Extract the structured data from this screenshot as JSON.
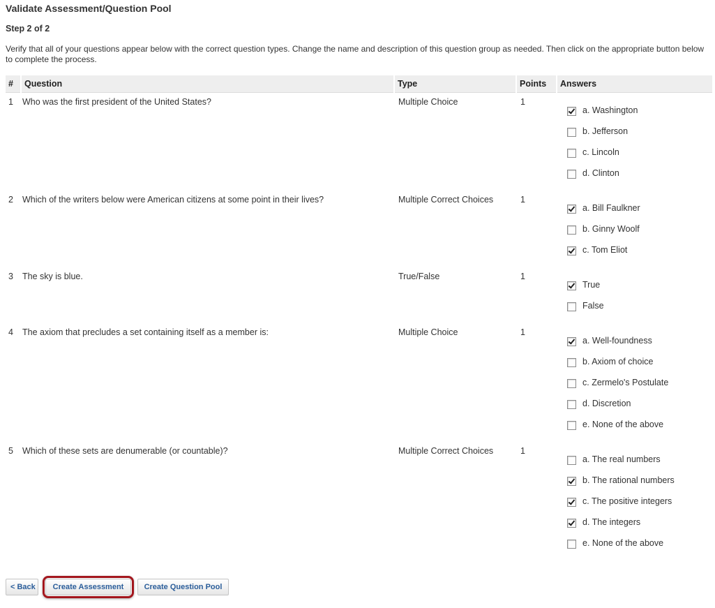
{
  "page": {
    "title": "Validate Assessment/Question Pool",
    "step": "Step 2 of 2",
    "instructions": "Verify that all of your questions appear below with the correct question types. Change the name and description of this question group as needed. Then click on the appropriate button below to complete the process."
  },
  "table": {
    "headers": {
      "num": "#",
      "question": "Question",
      "type": "Type",
      "points": "Points",
      "answers": "Answers"
    },
    "rows": [
      {
        "num": "1",
        "question": "Who was the first president of the United States?",
        "type": "Multiple Choice",
        "points": "1",
        "answers": [
          {
            "label": "a. Washington",
            "checked": true
          },
          {
            "label": "b. Jefferson",
            "checked": false
          },
          {
            "label": "c. Lincoln",
            "checked": false
          },
          {
            "label": "d. Clinton",
            "checked": false
          }
        ]
      },
      {
        "num": "2",
        "question": "Which of the writers below were American citizens at some point in their lives?",
        "type": "Multiple Correct Choices",
        "points": "1",
        "answers": [
          {
            "label": "a. Bill Faulkner",
            "checked": true
          },
          {
            "label": "b. Ginny Woolf",
            "checked": false
          },
          {
            "label": "c. Tom Eliot",
            "checked": true
          }
        ]
      },
      {
        "num": "3",
        "question": "The sky is blue.",
        "type": "True/False",
        "points": "1",
        "answers": [
          {
            "label": "True",
            "checked": true
          },
          {
            "label": "False",
            "checked": false
          }
        ]
      },
      {
        "num": "4",
        "question": "The axiom that precludes a set containing itself as a member is:",
        "type": "Multiple Choice",
        "points": "1",
        "answers": [
          {
            "label": "a. Well-foundness",
            "checked": true
          },
          {
            "label": "b. Axiom of choice",
            "checked": false
          },
          {
            "label": "c. Zermelo's Postulate",
            "checked": false
          },
          {
            "label": "d. Discretion",
            "checked": false
          },
          {
            "label": "e. None of the above",
            "checked": false
          }
        ]
      },
      {
        "num": "5",
        "question": "Which of these sets are denumerable (or countable)?",
        "type": "Multiple Correct Choices",
        "points": "1",
        "answers": [
          {
            "label": "a. The real numbers",
            "checked": false
          },
          {
            "label": "b. The rational numbers",
            "checked": true
          },
          {
            "label": "c. The positive integers",
            "checked": true
          },
          {
            "label": "d. The integers",
            "checked": true
          },
          {
            "label": "e. None of the above",
            "checked": false
          }
        ]
      }
    ]
  },
  "buttons": {
    "back": "< Back",
    "create_assessment": "Create Assessment",
    "create_pool": "Create Question Pool"
  },
  "colors": {
    "highlight": "#a3161d",
    "button_text": "#2a5d9a",
    "header_bg": "#eeeeee"
  }
}
